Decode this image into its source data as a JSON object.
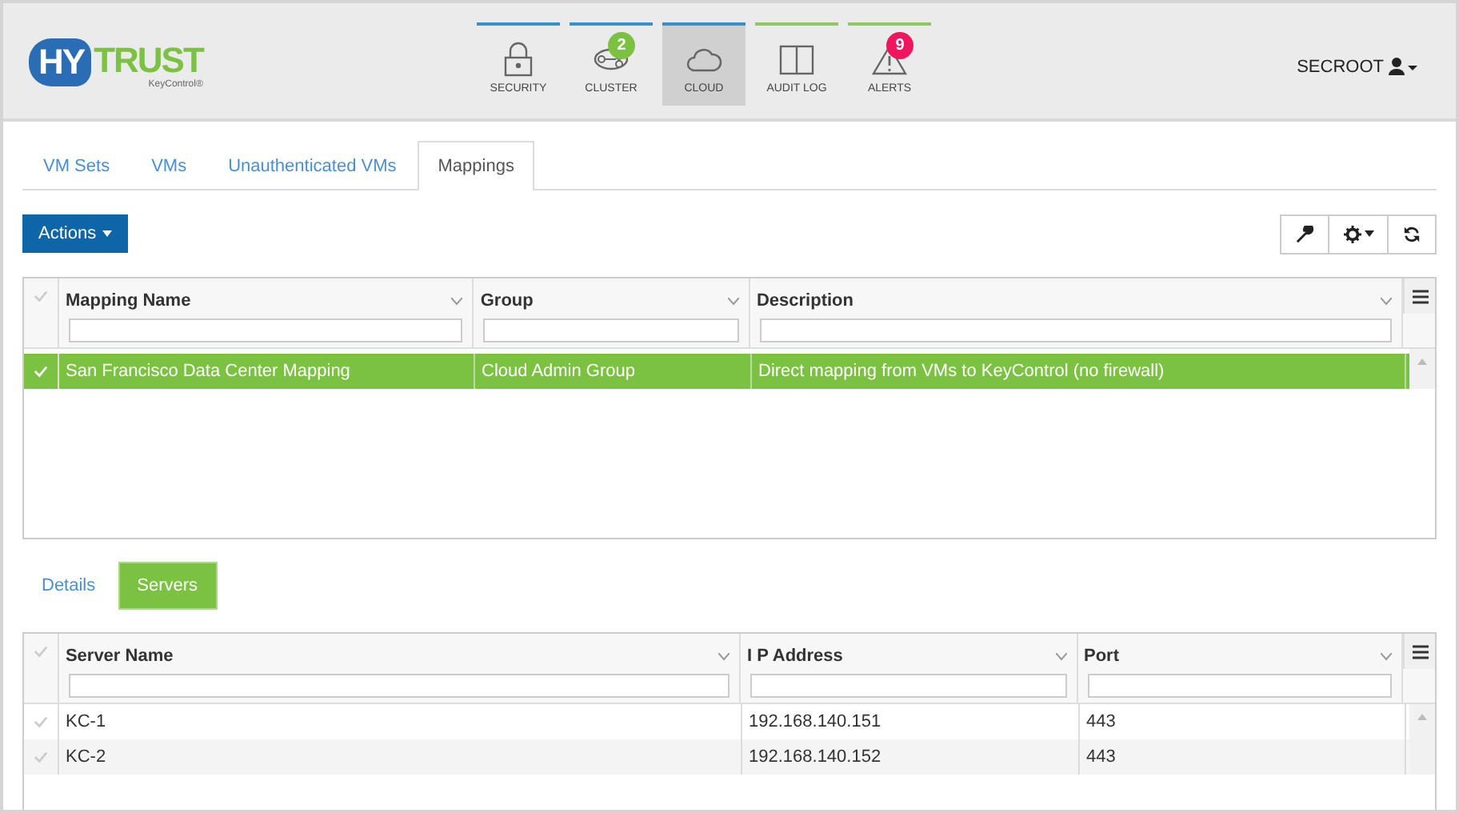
{
  "logo": {
    "mark": "HY",
    "word": "TRUST",
    "product": "KeyControl®"
  },
  "nav": [
    {
      "label": "SECURITY",
      "kind": "lock",
      "color": "#3a8fc7",
      "selected": false
    },
    {
      "label": "CLUSTER",
      "kind": "cluster",
      "color": "#3a8fc7",
      "selected": false,
      "badge": {
        "text": "2",
        "color": "#7cc242"
      }
    },
    {
      "label": "CLOUD",
      "kind": "cloud",
      "color": "#3a8fc7",
      "selected": true
    },
    {
      "label": "AUDIT LOG",
      "kind": "book",
      "color": "#8cc965",
      "selected": false
    },
    {
      "label": "ALERTS",
      "kind": "alert",
      "color": "#8cc965",
      "selected": false,
      "badge": {
        "text": "9",
        "color": "#f0155f"
      }
    }
  ],
  "user": {
    "name": "SECROOT"
  },
  "tabs": [
    {
      "label": "VM Sets",
      "selected": false
    },
    {
      "label": "VMs",
      "selected": false
    },
    {
      "label": "Unauthenticated VMs",
      "selected": false
    },
    {
      "label": "Mappings",
      "selected": true
    }
  ],
  "actions_button": {
    "label": "Actions"
  },
  "mappings_table": {
    "columns": [
      "Mapping Name",
      "Group",
      "Description"
    ],
    "rows": [
      {
        "cells": [
          "San Francisco Data Center Mapping",
          "Cloud Admin Group",
          "Direct mapping from VMs to KeyControl (no firewall)"
        ],
        "selected": true
      }
    ]
  },
  "detail_tabs": [
    {
      "label": "Details",
      "selected": false
    },
    {
      "label": "Servers",
      "selected": true
    }
  ],
  "servers_table": {
    "columns": [
      "Server Name",
      "I P Address",
      "Port"
    ],
    "rows": [
      {
        "cells": [
          "KC-1",
          "192.168.140.151",
          "443"
        ],
        "selected": false
      },
      {
        "cells": [
          "KC-2",
          "192.168.140.152",
          "443"
        ],
        "selected": false
      }
    ]
  }
}
